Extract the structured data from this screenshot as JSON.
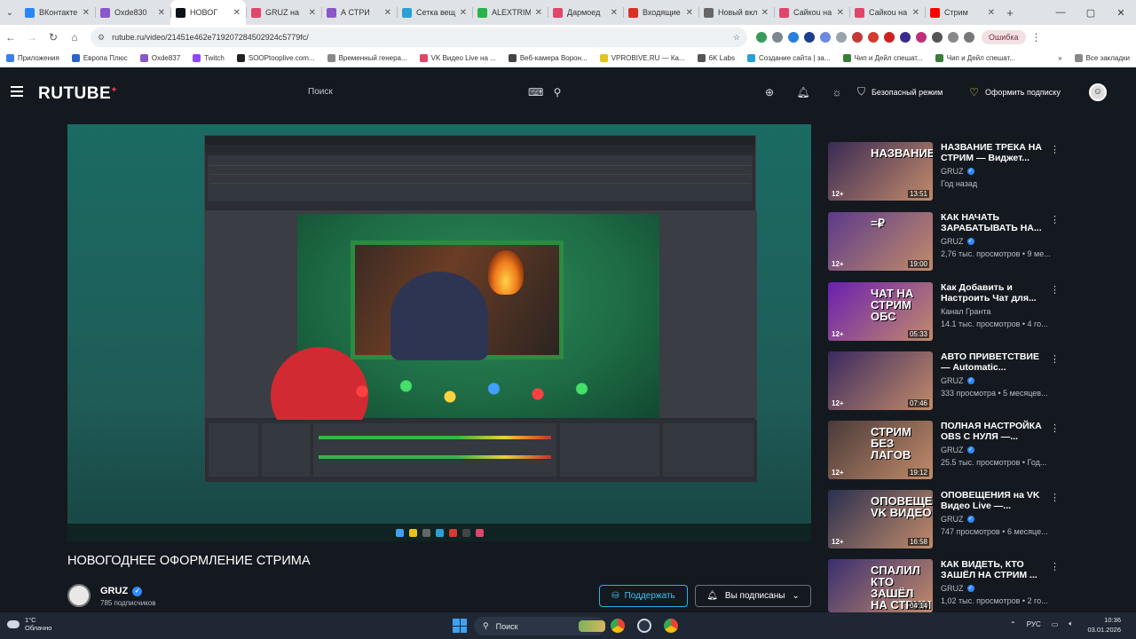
{
  "browser": {
    "tabs": [
      {
        "title": "ВКонтакте",
        "color": "#2787f5"
      },
      {
        "title": "Oxde830",
        "color": "#8a58c8"
      },
      {
        "title": "НОВОГ",
        "color": "#0c1018",
        "active": true
      },
      {
        "title": "GRUZ на",
        "color": "#e0456a"
      },
      {
        "title": "А СТРИ",
        "color": "#8a58c8"
      },
      {
        "title": "Сетка вещ",
        "color": "#2aa0d6"
      },
      {
        "title": "ALEXTRIM",
        "color": "#29b34a"
      },
      {
        "title": "Дармоед",
        "color": "#e0456a"
      },
      {
        "title": "Входящие",
        "color": "#d93025"
      },
      {
        "title": "Новый вкл",
        "color": "#666666"
      },
      {
        "title": "Сайкоu на",
        "color": "#e0456a"
      },
      {
        "title": "Сайкоu на",
        "color": "#e0456a"
      },
      {
        "title": "Стрим",
        "color": "#ff0000"
      }
    ],
    "url": "rutube.ru/video/21451e462e719207284502924c5779fc/",
    "error_label": "Ошибка",
    "bookmarks": [
      {
        "label": "Приложения",
        "color": "#3d7fea"
      },
      {
        "label": "Европа Плюс",
        "color": "#2a64c8"
      },
      {
        "label": "Oxde837",
        "color": "#8a58c8"
      },
      {
        "label": "Twitch",
        "color": "#9146ff"
      },
      {
        "label": "SOOPtooplive.com...",
        "color": "#222222"
      },
      {
        "label": "Временный генера...",
        "color": "#888888"
      },
      {
        "label": "VK Видео Live на ...",
        "color": "#e0456a"
      },
      {
        "label": "Веб-камера Ворон...",
        "color": "#444444"
      },
      {
        "label": "VPROBIVE.RU — Ка...",
        "color": "#e6c31c"
      },
      {
        "label": "6K Labs",
        "color": "#555555"
      },
      {
        "label": "Создание сайта | за...",
        "color": "#2aa0d6"
      },
      {
        "label": "Чип и Дейл спешат...",
        "color": "#3a7d3a"
      },
      {
        "label": "Чип и Дейл спешат...",
        "color": "#3a7d3a"
      }
    ],
    "all_bookmarks_label": "Все закладки"
  },
  "header": {
    "logo": "RUTUBE",
    "search_placeholder": "Поиск",
    "safe_mode_label": "Безопасный режим",
    "subscribe_label": "Оформить подписку"
  },
  "video": {
    "title": "НОВОГОДНЕЕ ОФОРМЛЕНИЕ СТРИМА",
    "channel": "GRUZ",
    "subscribers": "785 подписчиков",
    "donate_label": "Поддержать",
    "subscribed_label": "Вы подписаны"
  },
  "recommendations": [
    {
      "title": "НАЗВАНИЕ ТРЕКА НА СТРИМ — Виджет...",
      "channel": "GRUZ",
      "verified": true,
      "meta": "Год назад",
      "duration": "13:51",
      "age": "12+",
      "caption": "НАЗВАНИЕ",
      "bg": "#3a2a55"
    },
    {
      "title": "КАК НАЧАТЬ ЗАРАБАТЫВАТЬ НА...",
      "channel": "GRUZ",
      "verified": true,
      "meta": "2,76 тыс. просмотров • 9 ме...",
      "duration": "19:00",
      "age": "12+",
      "caption": "=₽",
      "bg": "#5b3a8a"
    },
    {
      "title": "Как Добавить и Настроить Чат для...",
      "channel": "Канал Гранта",
      "verified": false,
      "meta": "14.1 тыс. просмотров • 4 го...",
      "duration": "05:33",
      "age": "12+",
      "caption": "ЧАТ НА СТРИМ ОБС",
      "bg": "#6a1fb0"
    },
    {
      "title": "АВТО ПРИВЕТСТВИЕ — Automatic...",
      "channel": "GRUZ",
      "verified": true,
      "meta": "333 просмотра • 5 месяцев...",
      "duration": "07:46",
      "age": "12+",
      "caption": "",
      "bg": "#3b2a60"
    },
    {
      "title": "ПОЛНАЯ НАСТРОЙКА OBS С НУЛЯ —...",
      "channel": "GRUZ",
      "verified": true,
      "meta": "25.5 тыс. просмотров • Год...",
      "duration": "19:12",
      "age": "12+",
      "caption": "СТРИМ БЕЗ ЛАГОВ",
      "bg": "#4a3a3a"
    },
    {
      "title": "ОПОВЕЩЕНИЯ на VK Видео Live —...",
      "channel": "GRUZ",
      "verified": true,
      "meta": "747 просмотров • 6 месяце...",
      "duration": "16:58",
      "age": "12+",
      "caption": "ОПОВЕЩЕНИЯ VK ВИДЕО",
      "bg": "#2a3050"
    },
    {
      "title": "КАК ВИДЕТЬ, КТО ЗАШЁЛ НА СТРИМ ...",
      "channel": "GRUZ",
      "verified": true,
      "meta": "1,02 тыс. просмотров • 2 го...",
      "duration": "04:14",
      "age": "",
      "caption": "СПАЛИЛ КТО ЗАШЁЛ НА СТРИМ",
      "bg": "#3a2e70"
    }
  ],
  "taskbar": {
    "temperature": "1°C",
    "weather": "Облачно",
    "search_label": "Поиск",
    "lang": "РУС",
    "time": "10:36",
    "date": "03.01.2026"
  }
}
